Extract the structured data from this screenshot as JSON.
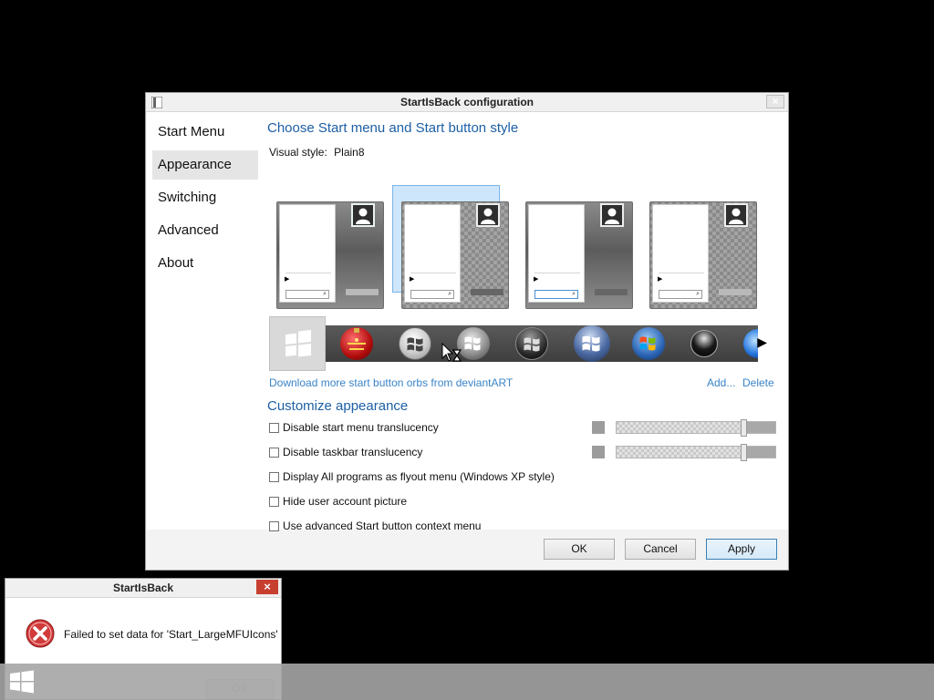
{
  "window": {
    "title": "StartIsBack configuration",
    "close_label": "×"
  },
  "nav": {
    "items": [
      {
        "label": "Start Menu",
        "active": false
      },
      {
        "label": "Appearance",
        "active": true
      },
      {
        "label": "Switching",
        "active": false
      },
      {
        "label": "Advanced",
        "active": false
      },
      {
        "label": "About",
        "active": false
      }
    ]
  },
  "main": {
    "heading": "Choose Start menu and Start button style",
    "visual_style_label": "Visual style:",
    "visual_style_value": "Plain8",
    "selected_style_index": 1,
    "orbs_count_visible": 9,
    "download_link": "Download more start button orbs from deviantART",
    "add_link": "Add...",
    "delete_link": "Delete",
    "customize_heading": "Customize appearance",
    "options": [
      {
        "label": "Disable start menu translucency",
        "checked": false
      },
      {
        "label": "Disable taskbar translucency",
        "checked": false
      },
      {
        "label": "Display All programs as flyout menu (Windows XP style)",
        "checked": false
      },
      {
        "label": "Hide user account picture",
        "checked": false
      },
      {
        "label": "Use advanced Start button context menu",
        "checked": false
      }
    ],
    "sliders": [
      {
        "name": "start-menu-translucency",
        "value": 0.8
      },
      {
        "name": "taskbar-translucency",
        "value": 0.8
      }
    ]
  },
  "footer": {
    "ok": "OK",
    "cancel": "Cancel",
    "apply": "Apply"
  },
  "error_dialog": {
    "title": "StartIsBack",
    "close_label": "×",
    "message": "Failed to set data for 'Start_LargeMFUIcons'",
    "ok": "OK",
    "icon": "error-x-icon"
  },
  "taskbar": {
    "start_icon": "windows-logo-icon"
  },
  "colors": {
    "accent": "#1d5fa5",
    "link": "#3a84c8",
    "selected_card": "#cde6fb",
    "error_red": "#c7402f"
  }
}
